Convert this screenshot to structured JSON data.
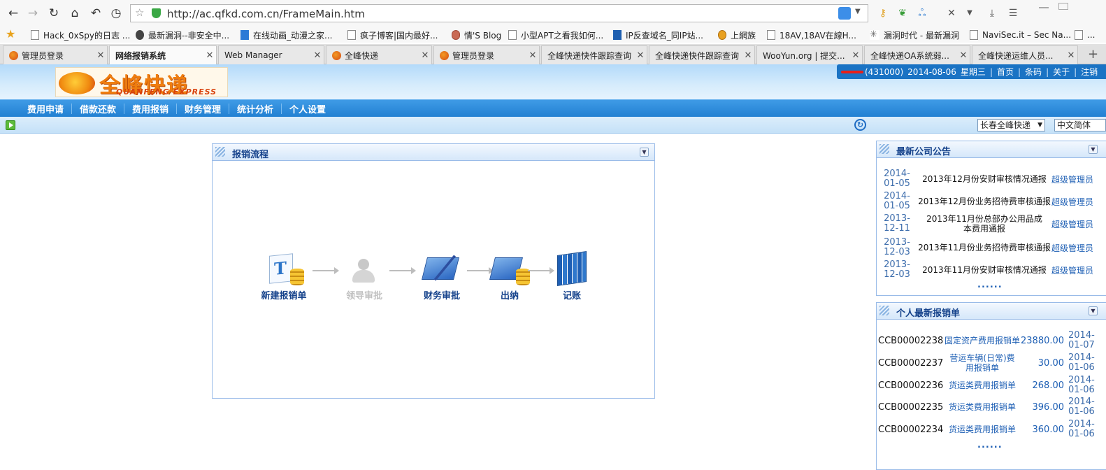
{
  "browser": {
    "url": "http://ac.qfkd.com.cn/FrameMain.htm",
    "bookmarks": [
      "Hack_0xSpy的日志 ...",
      "最新漏洞--非安全中...",
      "在线动画_动漫之家...",
      "疯子博客|国内最好...",
      "情'S Blog",
      "小型APT之看我如何...",
      "IP反查域名_同IP站...",
      "上網族",
      "18AV,18AV在線H...",
      "漏洞时代 - 最新漏洞",
      "NaviSec.it – Sec Na...",
      "..."
    ],
    "tabs": [
      "管理员登录",
      "网络报销系统",
      "Web Manager",
      "全峰快递",
      "管理员登录",
      "全峰快递快件跟踪查询",
      "全峰快递快件跟踪查询",
      "WooYun.org | 提交...",
      "全峰快递OA系统弱...",
      "全峰快递运维人员..."
    ],
    "active_tab": 1,
    "icons": [
      "back-icon",
      "forward-icon",
      "reload-icon",
      "home-icon",
      "undo-icon",
      "history-icon",
      "star-icon",
      "key-icon",
      "tools-icon",
      "download-icon",
      "menu-icon"
    ]
  },
  "header": {
    "logo_cn": "全峰快递",
    "logo_en": "QUANFENG EXPRESS",
    "user_code": "(431000)",
    "date": "2014-08-06",
    "weekday": "星期三",
    "links": [
      "首页",
      "条码",
      "关于",
      "注销"
    ]
  },
  "menu": [
    "费用申请",
    "借款还款",
    "费用报销",
    "财务管理",
    "统计分析",
    "个人设置"
  ],
  "toolbar": {
    "company_select": "长春全峰快递",
    "language_select": "中文简体"
  },
  "flow_panel": {
    "title": "报销流程",
    "steps": [
      {
        "label": "新建报销单",
        "enabled": true,
        "icon": "new-form-icon"
      },
      {
        "label": "领导审批",
        "enabled": false,
        "icon": "leader-approval-icon"
      },
      {
        "label": "财务审批",
        "enabled": true,
        "icon": "finance-approval-icon"
      },
      {
        "label": "出纳",
        "enabled": true,
        "icon": "cashier-icon"
      },
      {
        "label": "记账",
        "enabled": true,
        "icon": "bookkeeping-icon"
      }
    ]
  },
  "announcements": {
    "title": "最新公司公告",
    "items": [
      {
        "date": "2014-01-05",
        "title": "2013年12月份安财审核情况通报",
        "author": "超级管理员"
      },
      {
        "date": "2014-01-05",
        "title": "2013年12月份业务招待费审核通报",
        "author": "超级管理员"
      },
      {
        "date": "2013-12-11",
        "title": "2013年11月份总部办公用品成本费用通报",
        "author": "超级管理员"
      },
      {
        "date": "2013-12-03",
        "title": "2013年11月份业务招待费审核通报",
        "author": "超级管理员"
      },
      {
        "date": "2013-12-03",
        "title": "2013年11月份安财审核情况通报",
        "author": "超级管理员"
      }
    ],
    "more": "......"
  },
  "my_forms": {
    "title": "个人最新报销单",
    "items": [
      {
        "code": "CCB00002238",
        "type": "固定资产费用报销单",
        "amount": "23880.00",
        "date": "2014-01-07"
      },
      {
        "code": "CCB00002237",
        "type": "营运车辆(日常)费用报销单",
        "amount": "30.00",
        "date": "2014-01-06"
      },
      {
        "code": "CCB00002236",
        "type": "货运类费用报销单",
        "amount": "268.00",
        "date": "2014-01-06"
      },
      {
        "code": "CCB00002235",
        "type": "货运类费用报销单",
        "amount": "396.00",
        "date": "2014-01-06"
      },
      {
        "code": "CCB00002234",
        "type": "货运类费用报销单",
        "amount": "360.00",
        "date": "2014-01-06"
      }
    ],
    "more": "......"
  },
  "colors": {
    "menu_blue": "#2280d2",
    "panel_title": "#15428b",
    "link_blue": "#1e5fb4",
    "logo_orange": "#ef7d0f"
  }
}
